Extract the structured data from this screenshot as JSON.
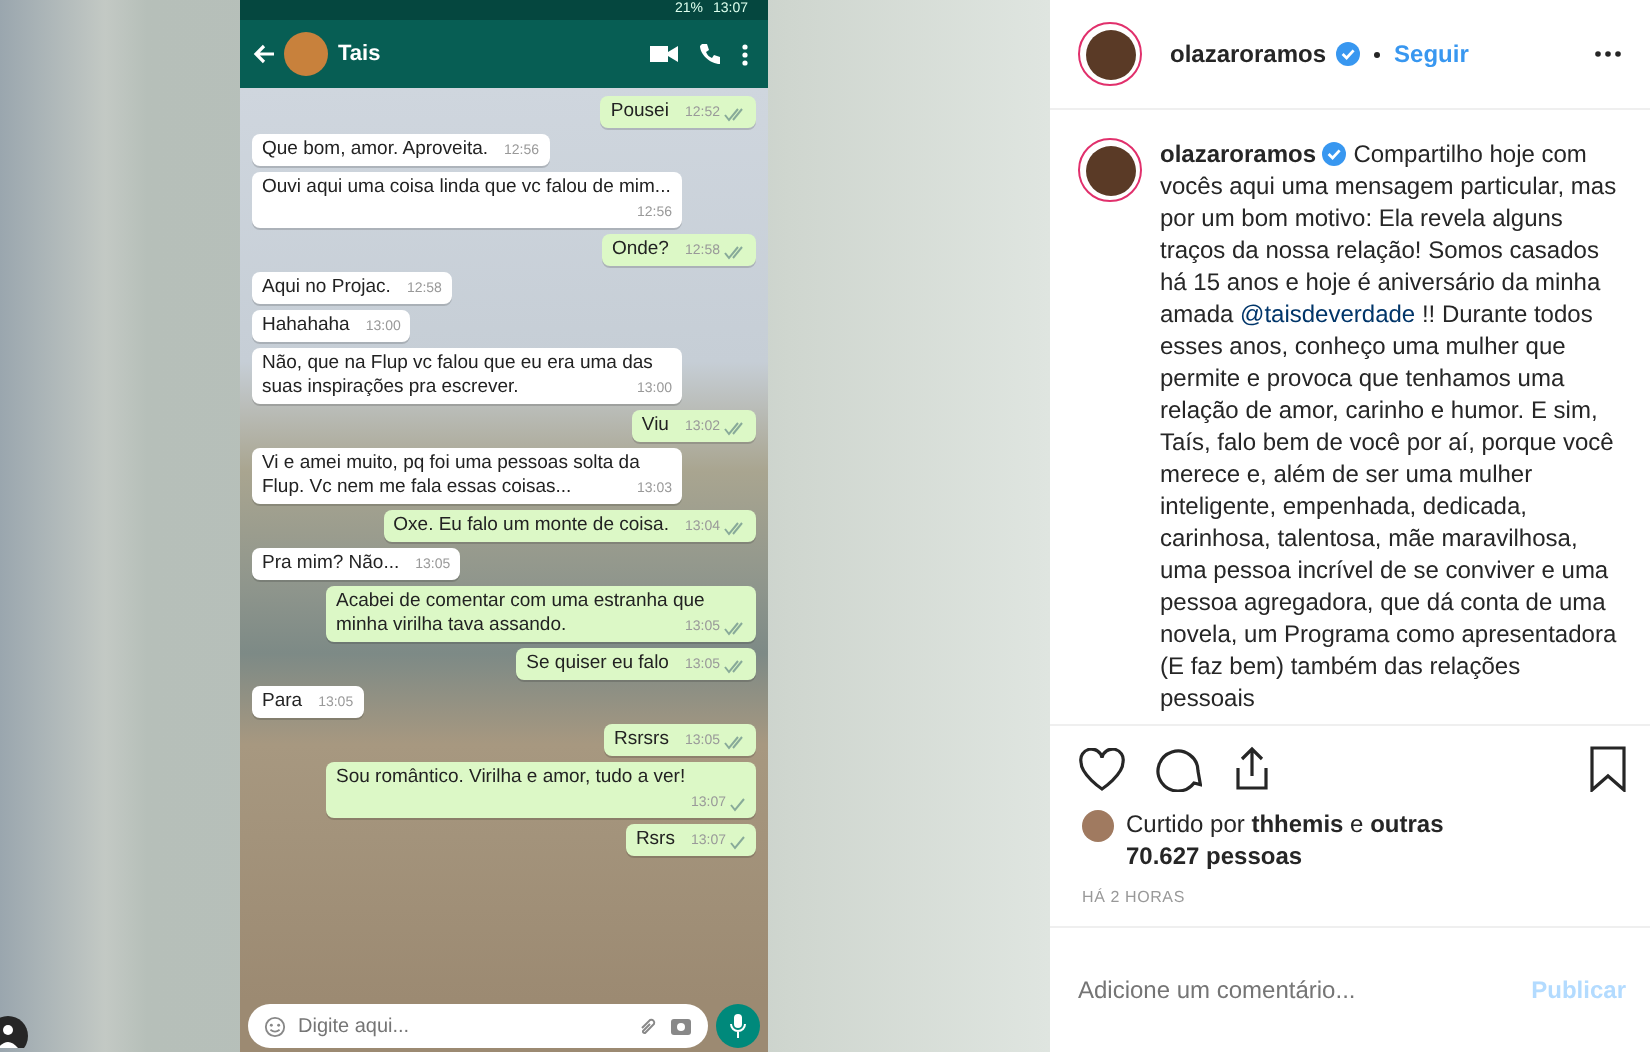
{
  "phone": {
    "status_bar": {
      "battery": "21%",
      "time": "13:07"
    },
    "chat_header": {
      "contact": "Tais"
    },
    "messages": [
      {
        "kind": "out",
        "text": "Pousei",
        "time": "12:52",
        "read": true
      },
      {
        "kind": "in",
        "text": "Que bom, amor. Aproveita.",
        "time": "12:56"
      },
      {
        "kind": "in",
        "text": "Ouvi aqui uma coisa linda que vc falou de mim...",
        "time": "12:56"
      },
      {
        "kind": "out",
        "text": "Onde?",
        "time": "12:58",
        "read": true
      },
      {
        "kind": "in",
        "text": "Aqui no Projac.",
        "time": "12:58"
      },
      {
        "kind": "in",
        "text": "Hahahaha",
        "time": "13:00"
      },
      {
        "kind": "in",
        "text": "Não, que na Flup vc falou que eu era uma das suas inspirações pra escrever.",
        "time": "13:00"
      },
      {
        "kind": "out",
        "text": "Viu",
        "time": "13:02",
        "read": true
      },
      {
        "kind": "in",
        "text": "Vi e amei muito, pq foi uma pessoas solta da Flup. Vc nem me fala essas coisas...",
        "time": "13:03"
      },
      {
        "kind": "out",
        "text": "Oxe. Eu falo um monte de coisa.",
        "time": "13:04",
        "read": true
      },
      {
        "kind": "in",
        "text": "Pra mim? Não...",
        "time": "13:05"
      },
      {
        "kind": "out",
        "text": "Acabei de comentar com uma estranha que minha virilha tava assando.",
        "time": "13:05",
        "read": true
      },
      {
        "kind": "out",
        "text": "Se quiser eu falo",
        "time": "13:05",
        "read": true
      },
      {
        "kind": "in",
        "text": "Para",
        "time": "13:05"
      },
      {
        "kind": "out",
        "text": "Rsrsrs",
        "time": "13:05",
        "read": true
      },
      {
        "kind": "out",
        "text": "Sou romântico.  Virilha e amor, tudo a ver!",
        "time": "13:07",
        "read": false
      },
      {
        "kind": "out",
        "text": "Rsrs",
        "time": "13:07",
        "read": false
      }
    ],
    "input": {
      "placeholder": "Digite aqui..."
    }
  },
  "post_header": {
    "username": "olazaroramos",
    "follow": "Seguir"
  },
  "caption": {
    "username": "olazaroramos",
    "text_before": "Compartilho hoje com vocês aqui uma mensagem particular, mas por um bom motivo: Ela revela alguns traços da nossa relação! Somos casados há 15 anos e hoje é aniversário da minha amada",
    "mention": "@taisdeverdade",
    "text_after": "!! Durante todos esses anos, conheço uma mulher que permite e provoca que tenhamos uma relação de amor, carinho e humor. E sim, Taís, falo bem de você por aí, porque você merece e, além de ser uma mulher inteligente, empenhada, dedicada, carinhosa, talentosa, mãe maravilhosa, uma pessoa incrível de se conviver e uma pessoa agregadora, que dá conta de uma novela, um Programa como apresentadora (E faz bem) também das relações pessoais"
  },
  "likes": "Curtido por **thhemis** e **outras 70.627 pessoas**",
  "timestamp": "HÁ 2 HORAS",
  "comment": {
    "placeholder": "Adicione um comentário...",
    "submit": "Publicar"
  }
}
